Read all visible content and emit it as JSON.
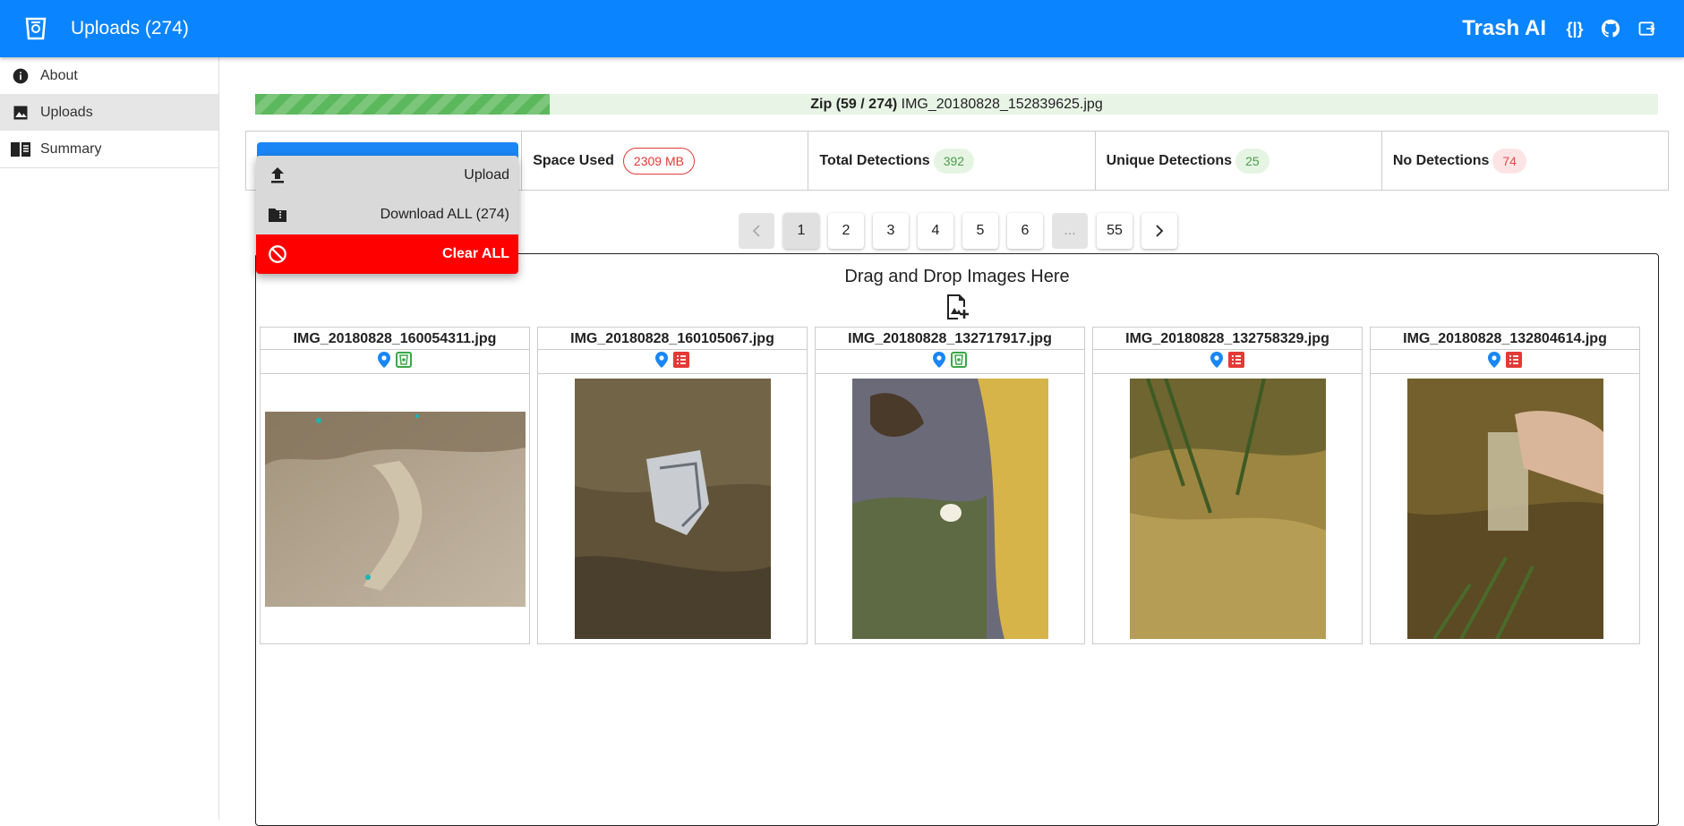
{
  "appbar": {
    "title": "Uploads (274)",
    "brand": "Trash AI",
    "json_icon": "{|}"
  },
  "sidebar": {
    "items": [
      {
        "label": "About",
        "icon": "info-icon"
      },
      {
        "label": "Uploads",
        "icon": "image-icon"
      },
      {
        "label": "Summary",
        "icon": "book-icon"
      }
    ]
  },
  "progress": {
    "label": "Zip (59 / 274)",
    "filename": " IMG_20180828_152839625.jpg",
    "fraction": 0.21
  },
  "stats": {
    "space_used": {
      "label": "Space Used",
      "value": "2309 MB"
    },
    "total_detections": {
      "label": "Total Detections",
      "value": "392"
    },
    "unique_detections": {
      "label": "Unique Detections",
      "value": "25"
    },
    "no_detections": {
      "label": "No Detections",
      "value": "74"
    }
  },
  "menu": {
    "upload": "Upload",
    "download_all": "Download ALL (274)",
    "clear_all": "Clear ALL"
  },
  "pagination": {
    "pages": [
      "1",
      "2",
      "3",
      "4",
      "5",
      "6",
      "...",
      "55"
    ],
    "current": "1"
  },
  "dropzone": {
    "title": "Drag and Drop Images Here"
  },
  "images": [
    {
      "filename": "IMG_20180828_160054311.jpg",
      "status": "detected"
    },
    {
      "filename": "IMG_20180828_160105067.jpg",
      "status": "no-detection"
    },
    {
      "filename": "IMG_20180828_132717917.jpg",
      "status": "detected"
    },
    {
      "filename": "IMG_20180828_132758329.jpg",
      "status": "no-detection"
    },
    {
      "filename": "IMG_20180828_132804614.jpg",
      "status": "no-detection"
    }
  ],
  "colors": {
    "primary": "#0a84ff",
    "danger": "#ff0000",
    "success": "#4a9c4a"
  }
}
